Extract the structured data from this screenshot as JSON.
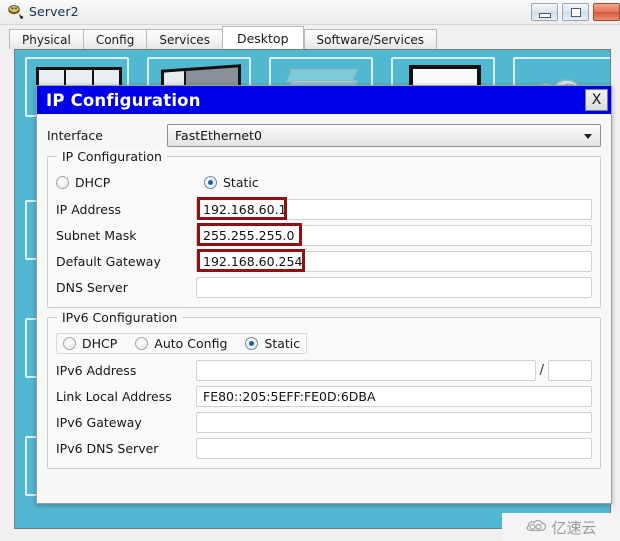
{
  "window": {
    "title": "Server2",
    "icon": "server-device-icon",
    "buttons": {
      "minimize": "minimize-icon",
      "maximize": "maximize-icon",
      "close": "close-icon"
    }
  },
  "tabs": [
    {
      "label": "Physical",
      "active": false
    },
    {
      "label": "Config",
      "active": false
    },
    {
      "label": "Services",
      "active": false
    },
    {
      "label": "Desktop",
      "active": true
    },
    {
      "label": "Software/Services",
      "active": false
    }
  ],
  "desktop": {
    "background_color": "#52b8d2",
    "icons": [
      "web-browser-icon",
      "command-prompt-icon",
      "text-editor-icon",
      "monitor-icon",
      "cloud-icon"
    ]
  },
  "dialog": {
    "title": "IP Configuration",
    "title_bar_color": "#0000e8",
    "close_label": "X",
    "interface": {
      "label": "Interface",
      "value": "FastEthernet0",
      "options": [
        "FastEthernet0"
      ]
    },
    "ipv4": {
      "group_title": "IP Configuration",
      "mode_options": [
        {
          "label": "DHCP",
          "selected": false
        },
        {
          "label": "Static",
          "selected": true
        }
      ],
      "fields": [
        {
          "label": "IP Address",
          "value": "192.168.60.1",
          "highlighted": true
        },
        {
          "label": "Subnet Mask",
          "value": "255.255.255.0",
          "highlighted": true
        },
        {
          "label": "Default Gateway",
          "value": "192.168.60.254",
          "highlighted": true
        },
        {
          "label": "DNS Server",
          "value": "",
          "highlighted": false
        }
      ]
    },
    "ipv6": {
      "group_title": "IPv6 Configuration",
      "mode_options": [
        {
          "label": "DHCP",
          "selected": false
        },
        {
          "label": "Auto Config",
          "selected": false
        },
        {
          "label": "Static",
          "selected": true
        }
      ],
      "address": {
        "label": "IPv6 Address",
        "value": "",
        "separator": "/",
        "prefix": ""
      },
      "fields": [
        {
          "label": "Link Local Address",
          "value": "FE80::205:5EFF:FE0D:6DBA"
        },
        {
          "label": "IPv6 Gateway",
          "value": ""
        },
        {
          "label": "IPv6 DNS Server",
          "value": ""
        }
      ]
    }
  },
  "annotation": {
    "color": "#8e1010"
  },
  "watermark": {
    "text": "亿速云",
    "icon": "cloud-icon"
  }
}
